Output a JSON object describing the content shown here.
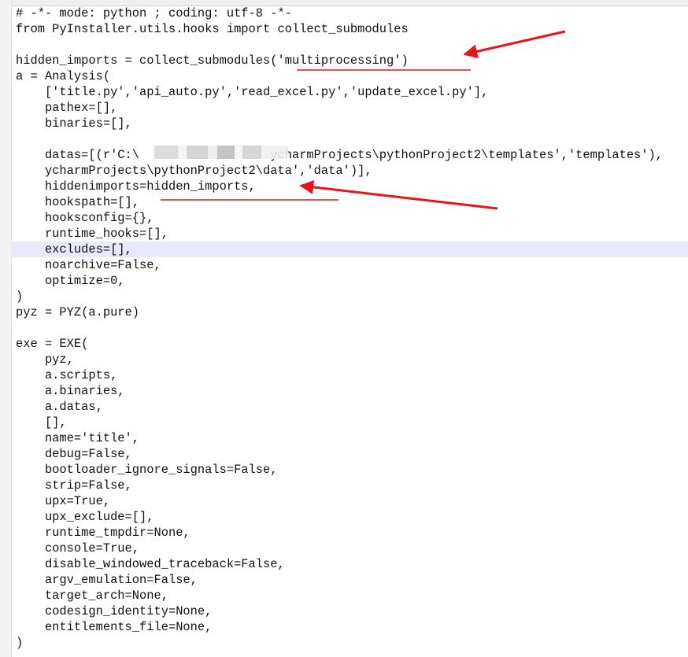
{
  "editor": {
    "lines": [
      "# -*- mode: python ; coding: utf-8 -*-",
      "from PyInstaller.utils.hooks import collect_submodules",
      "",
      "hidden_imports = collect_submodules('multiprocessing')",
      "a = Analysis(",
      "    ['title.py','api_auto.py','read_excel.py','update_excel.py'],",
      "    pathex=[],",
      "    binaries=[],",
      "",
      "    datas=[(r'C:\\                  ycharmProjects\\pythonProject2\\templates','templates'),",
      "    ycharmProjects\\pythonProject2\\data','data')],",
      "    hiddenimports=hidden_imports,",
      "    hookspath=[],",
      "    hooksconfig={},",
      "    runtime_hooks=[],",
      "    excludes=[],",
      "    noarchive=False,",
      "    optimize=0,",
      ")",
      "pyz = PYZ(a.pure)",
      "",
      "exe = EXE(",
      "    pyz,",
      "    a.scripts,",
      "    a.binaries,",
      "    a.datas,",
      "    [],",
      "    name='title',",
      "    debug=False,",
      "    bootloader_ignore_signals=False,",
      "    strip=False,",
      "    upx=True,",
      "    upx_exclude=[],",
      "    runtime_tmpdir=None,",
      "    console=True,",
      "    disable_windowed_traceback=False,",
      "    argv_emulation=False,",
      "    target_arch=None,",
      "    codesign_identity=None,",
      "    entitlements_file=None,",
      ")"
    ],
    "active_line_index": 15
  },
  "annotation_color": "#e8141c"
}
